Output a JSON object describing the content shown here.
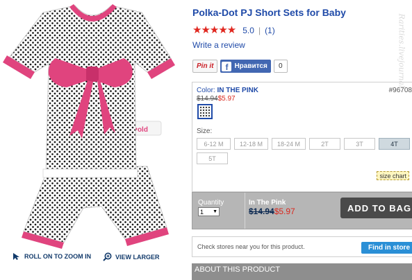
{
  "product": {
    "title": "Polka-Dot PJ Short Sets for Baby",
    "rating_stars": "★★★★★",
    "rating_value": "5.0",
    "rating_separator": "|",
    "rating_count": "(1)",
    "write_review": "Write a review"
  },
  "social": {
    "pinit_label": "Pin it",
    "fb_icon": "f",
    "fb_like_label": "Нравится",
    "fb_like_count": "0"
  },
  "options": {
    "color_prefix": "Color:",
    "color_name": "IN THE PINK",
    "item_number": "#96708",
    "old_price": "$14.94",
    "sale_price": "$5.97",
    "size_label": "Size:",
    "sizes": [
      "6-12 M",
      "12-18 M",
      "18-24 M",
      "2T",
      "3T",
      "4T",
      "5T"
    ],
    "selected_size": "4T",
    "size_chart": "size chart"
  },
  "purchase": {
    "quantity_label": "Quantity",
    "quantity_value": "1",
    "quantity_arrow": "▼",
    "color_name": "In The Pink",
    "old_price": "$14.94",
    "sale_price": "$5.97",
    "add_to_bag": "ADD TO BAG"
  },
  "stores": {
    "text": "Check stores near you for this product.",
    "button": "Find in store"
  },
  "about": {
    "header": "ABOUT THIS PRODUCT"
  },
  "image_actions": {
    "zoom": "ROLL ON TO ZOOM IN",
    "larger": "VIEW LARGER"
  },
  "watermark": "Rarities.livejournal",
  "colors": {
    "link_blue": "#1f4aa8",
    "sale_red": "#d9281e",
    "fabric_pink": "#e0447e",
    "bar_gray": "#b6b6b6",
    "store_button_blue": "#2a8fd6"
  }
}
